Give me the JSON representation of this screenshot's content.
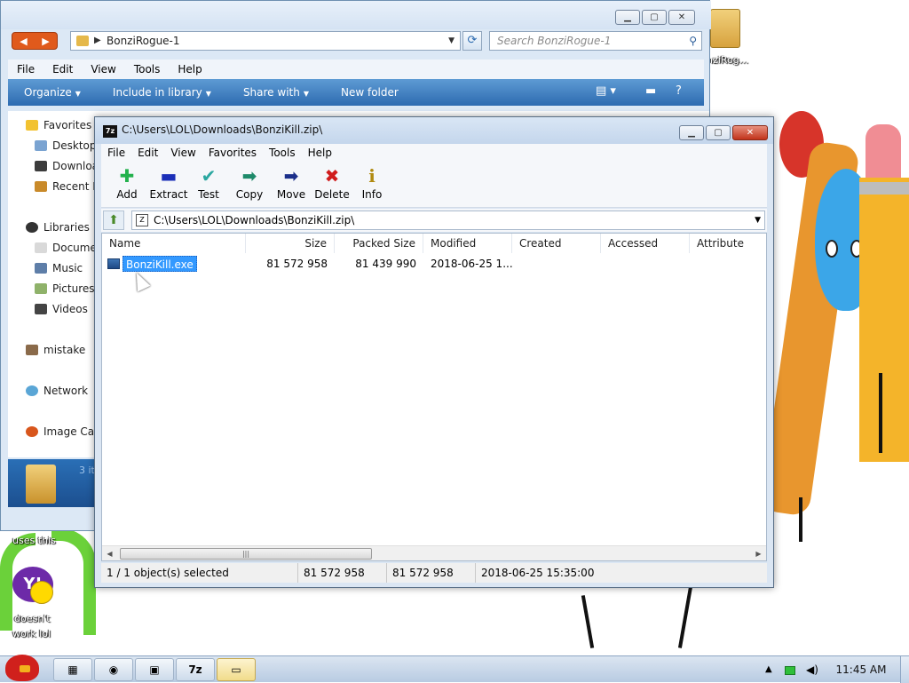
{
  "desktop": {
    "icons": [
      {
        "label": "nziRog..."
      },
      {
        "label": "uses this"
      },
      {
        "label": "doesn't"
      },
      {
        "label": "work lol"
      }
    ]
  },
  "explorer": {
    "address": "BonziRogue-1",
    "search_placeholder": "Search BonziRogue-1",
    "menu": [
      "File",
      "Edit",
      "View",
      "Tools",
      "Help"
    ],
    "toolbar": {
      "organize": "Organize",
      "include_in_library": "Include in library",
      "share_with": "Share with",
      "new_folder": "New folder"
    },
    "nav": {
      "favorites": "Favorites",
      "desktop": "Desktop",
      "downloads": "Downloa",
      "recent": "Recent P",
      "libraries": "Libraries",
      "documents": "Docume",
      "music": "Music",
      "pictures": "Pictures",
      "videos": "Videos",
      "mistake": "mistake",
      "network": "Network",
      "image_cat": "Image Cat"
    },
    "details_count": "3 it"
  },
  "sevenzip": {
    "title": "C:\\Users\\LOL\\Downloads\\BonziKill.zip\\",
    "menu": [
      "File",
      "Edit",
      "View",
      "Favorites",
      "Tools",
      "Help"
    ],
    "toolbar": [
      {
        "label": "Add",
        "icon": "plus-icon",
        "glyph": "✚",
        "color": "#22b14c"
      },
      {
        "label": "Extract",
        "icon": "minus-icon",
        "glyph": "▬",
        "color": "#1b2fb8"
      },
      {
        "label": "Test",
        "icon": "check-chevron-icon",
        "glyph": "✔",
        "color": "#2aa7a0"
      },
      {
        "label": "Copy",
        "icon": "copy-arrow-icon",
        "glyph": "➡",
        "color": "#1e8a6a"
      },
      {
        "label": "Move",
        "icon": "move-arrow-icon",
        "glyph": "➡",
        "color": "#1b2f8a"
      },
      {
        "label": "Delete",
        "icon": "delete-x-icon",
        "glyph": "✖",
        "color": "#d01c1c"
      },
      {
        "label": "Info",
        "icon": "info-icon",
        "glyph": "i",
        "color": "#b08a10"
      }
    ],
    "address": "C:\\Users\\LOL\\Downloads\\BonziKill.zip\\",
    "columns": {
      "name": "Name",
      "size": "Size",
      "packed_size": "Packed Size",
      "modified": "Modified",
      "created": "Created",
      "accessed": "Accessed",
      "attributes": "Attribute"
    },
    "rows": [
      {
        "name": "BonziKill.exe",
        "size": "81 572 958",
        "packed_size": "81 439 990",
        "modified": "2018-06-25 1..."
      }
    ],
    "status": {
      "selection": "1 / 1 object(s) selected",
      "size": "81 572 958",
      "packed": "81 572 958",
      "date": "2018-06-25 15:35:00"
    }
  },
  "taskbar": {
    "clock": "11:45 AM",
    "buttons": [
      {
        "label": "windows-explorer",
        "glyph": "▦"
      },
      {
        "label": "chrome",
        "glyph": "◉"
      },
      {
        "label": "app",
        "glyph": "▣"
      },
      {
        "label": "7z",
        "glyph": "7z"
      },
      {
        "label": "folder",
        "glyph": "▭"
      }
    ]
  }
}
